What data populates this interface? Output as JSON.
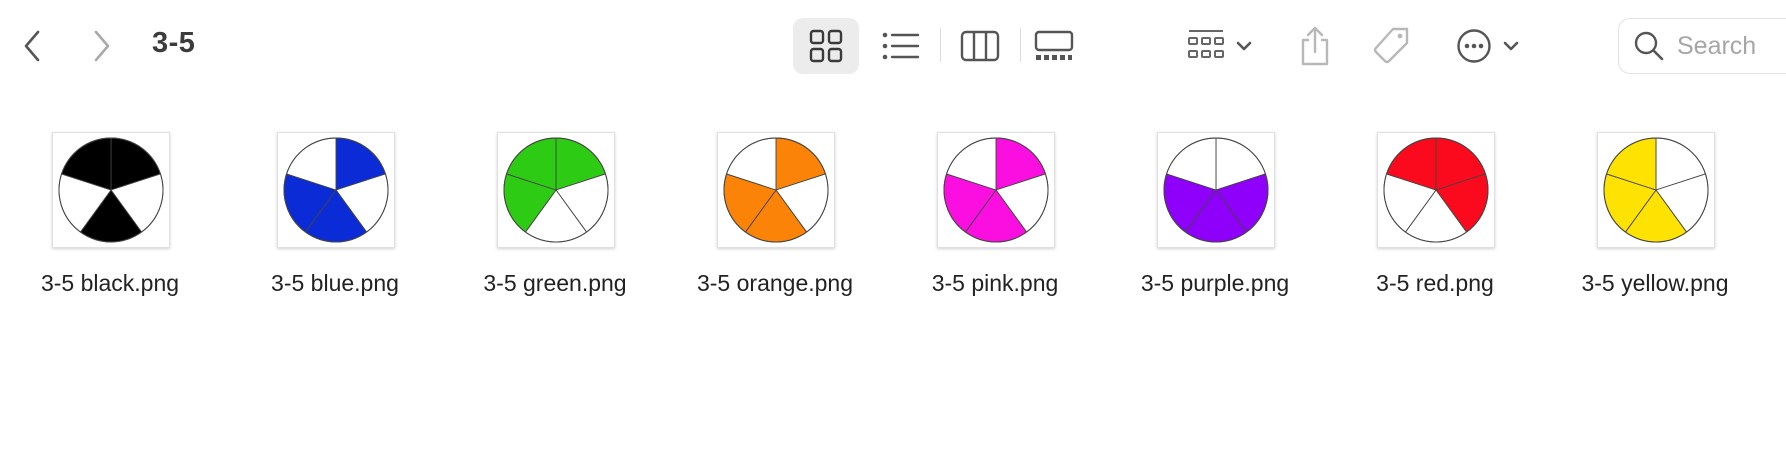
{
  "window": {
    "title": "3-5"
  },
  "toolbar": {
    "back_icon": "chevron-left-icon",
    "forward_icon": "chevron-right-icon",
    "views": [
      "icon-view-icon",
      "list-view-icon",
      "column-view-icon",
      "gallery-view-icon"
    ],
    "selected_view": "icon-view-icon",
    "group_icon": "group-by-icon",
    "share_icon": "share-icon",
    "tag_icon": "tag-icon",
    "more_icon": "ellipsis-circle-icon"
  },
  "search": {
    "placeholder": "Search"
  },
  "files": [
    {
      "name": "3-5 black.png",
      "color": "#000000",
      "shaded": [
        0,
        2,
        4
      ]
    },
    {
      "name": "3-5 blue.png",
      "color": "#0a2bd6",
      "shaded": [
        0,
        2,
        3
      ]
    },
    {
      "name": "3-5 green.png",
      "color": "#2ecb14",
      "shaded": [
        0,
        3,
        4
      ]
    },
    {
      "name": "3-5 orange.png",
      "color": "#fb8307",
      "shaded": [
        0,
        2,
        3
      ]
    },
    {
      "name": "3-5 pink.png",
      "color": "#fa0fe0",
      "shaded": [
        0,
        2,
        3
      ]
    },
    {
      "name": "3-5 purple.png",
      "color": "#8f00fa",
      "shaded": [
        1,
        2,
        3
      ]
    },
    {
      "name": "3-5 red.png",
      "color": "#fa0a1c",
      "shaded": [
        0,
        1,
        4
      ]
    },
    {
      "name": "3-5 yellow.png",
      "color": "#fde202",
      "shaded": [
        2,
        3,
        4
      ]
    }
  ]
}
